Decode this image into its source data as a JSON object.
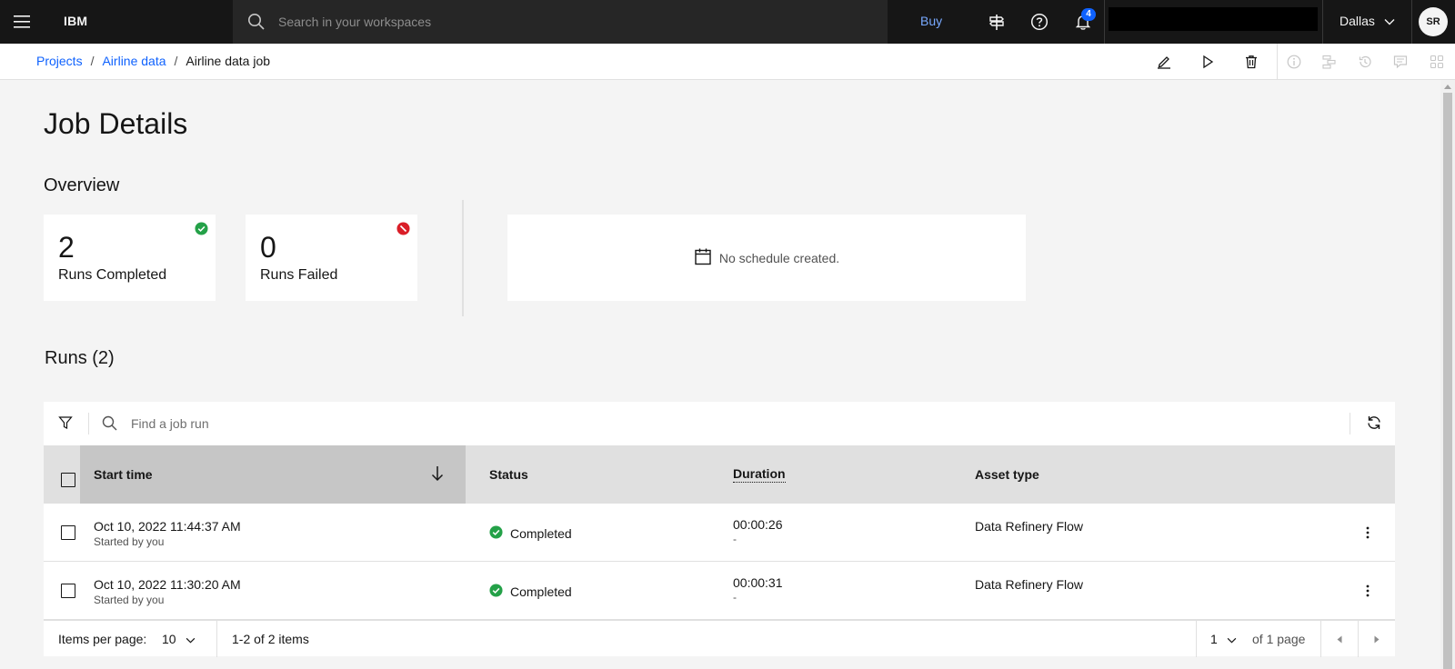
{
  "header": {
    "brand": "IBM",
    "search_placeholder": "Search in your workspaces",
    "buy_label": "Buy",
    "notification_count": "4",
    "region": "Dallas",
    "avatar_initials": "SR"
  },
  "breadcrumb": {
    "items": [
      "Projects",
      "Airline data"
    ],
    "current": "Airline data job",
    "separator": "/"
  },
  "page": {
    "title": "Job Details",
    "overview_title": "Overview"
  },
  "overview": {
    "completed": {
      "count": "2",
      "label": "Runs Completed"
    },
    "failed": {
      "count": "0",
      "label": "Runs Failed"
    },
    "schedule_text": "No schedule created."
  },
  "runs": {
    "title": "Runs (2)",
    "search_placeholder": "Find a job run",
    "columns": {
      "start_time": "Start time",
      "status": "Status",
      "duration": "Duration",
      "asset_type": "Asset type"
    },
    "rows": [
      {
        "start_time": "Oct 10, 2022 11:44:37 AM",
        "started_by": "Started by you",
        "status": "Completed",
        "duration": "00:00:26",
        "duration_sub": "-",
        "asset_type": "Data Refinery Flow"
      },
      {
        "start_time": "Oct 10, 2022 11:30:20 AM",
        "started_by": "Started by you",
        "status": "Completed",
        "duration": "00:00:31",
        "duration_sub": "-",
        "asset_type": "Data Refinery Flow"
      }
    ]
  },
  "pagination": {
    "items_per_page_label": "Items per page:",
    "items_per_page_value": "10",
    "range_text": "1-2 of 2 items",
    "current_page": "1",
    "of_pages_text": "of 1 page"
  },
  "colors": {
    "header_bg": "#161616",
    "link_blue": "#0f62fe",
    "success_green": "#24a148",
    "error_red": "#da1e28"
  }
}
